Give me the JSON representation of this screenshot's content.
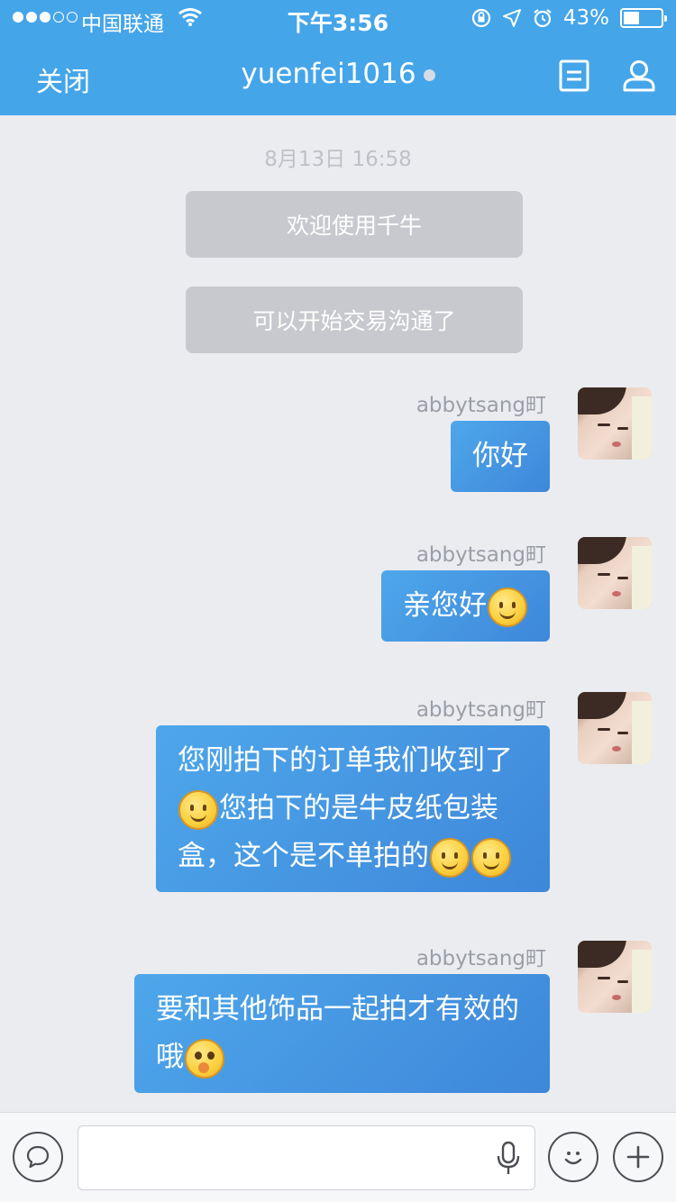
{
  "status_bar": {
    "carrier": "中国联通",
    "time": "下午3:56",
    "battery": "43%",
    "battery_level": 0.43
  },
  "nav": {
    "close_label": "关闭",
    "title": "yuenfei1016"
  },
  "chat": {
    "timestamp": "8月13日 16:58",
    "system_messages": [
      "欢迎使用千牛",
      "可以开始交易沟通了"
    ],
    "messages": [
      {
        "sender": "abbytsang町",
        "text_1": "你好"
      },
      {
        "sender": "abbytsang町",
        "text_1": "亲您好"
      },
      {
        "sender": "abbytsang町",
        "text_1": "您刚拍下的订单我们收到了",
        "text_2": "您拍下的是牛皮纸包装",
        "text_3": "盒，这个是不单拍的"
      },
      {
        "sender": "abbytsang町",
        "text_1": "要和其他饰品一起拍才有效的",
        "text_2": "哦"
      }
    ]
  },
  "input_bar": {
    "placeholder": ""
  },
  "colors": {
    "header": "#45a5e9",
    "bubble_start": "#4ea7ea",
    "bubble_end": "#3e87da",
    "system_bubble": "#c8c9ce",
    "background": "#ebecf0"
  }
}
